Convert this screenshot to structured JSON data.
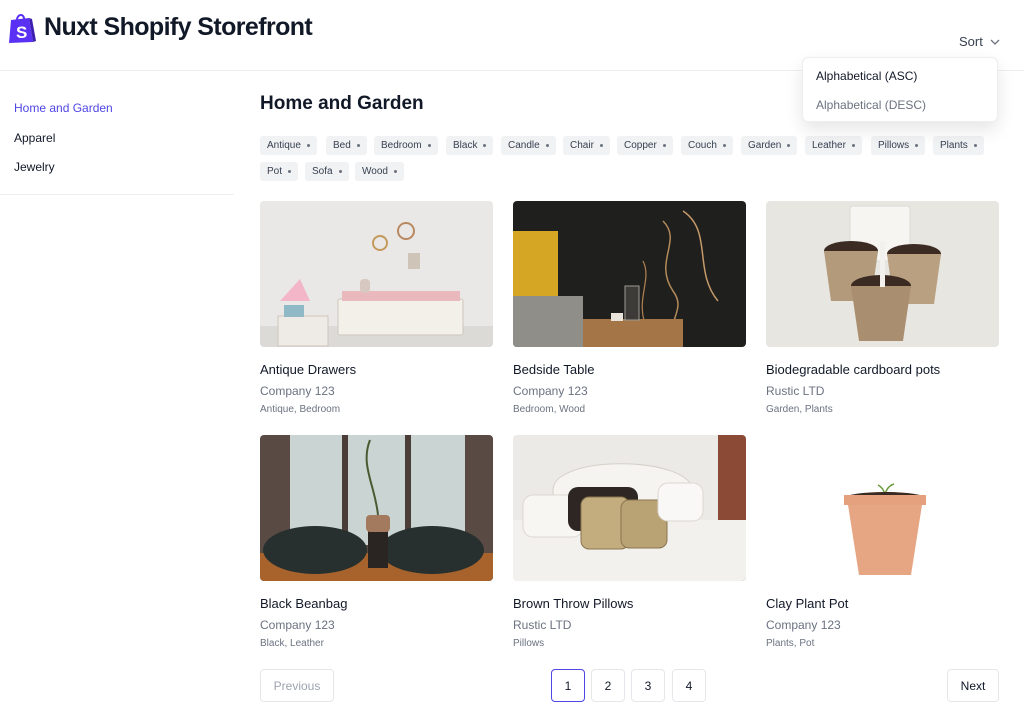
{
  "header": {
    "brand": "Nuxt Shopify Storefront",
    "logo_icon": "shopify-bag-icon",
    "sort_label": "Sort",
    "sort_options": [
      {
        "label": "Alphabetical (ASC)"
      },
      {
        "label": "Alphabetical (DESC)"
      }
    ]
  },
  "sidebar": {
    "items": [
      {
        "label": "Home and Garden",
        "active": true
      },
      {
        "label": "Apparel"
      },
      {
        "label": "Jewelry"
      }
    ]
  },
  "main": {
    "title": "Home and Garden",
    "tags": [
      "Antique",
      "Bed",
      "Bedroom",
      "Black",
      "Candle",
      "Chair",
      "Copper",
      "Couch",
      "Garden",
      "Leather",
      "Pillows",
      "Plants",
      "Pot",
      "Sofa",
      "Wood"
    ],
    "products": [
      {
        "title": "Antique Drawers",
        "vendor": "Company 123",
        "tags": "Antique, Bedroom"
      },
      {
        "title": "Bedside Table",
        "vendor": "Company 123",
        "tags": "Bedroom, Wood"
      },
      {
        "title": "Biodegradable cardboard pots",
        "vendor": "Rustic LTD",
        "tags": "Garden, Plants"
      },
      {
        "title": "Black Beanbag",
        "vendor": "Company 123",
        "tags": "Black, Leather"
      },
      {
        "title": "Brown Throw Pillows",
        "vendor": "Rustic LTD",
        "tags": "Pillows"
      },
      {
        "title": "Clay Plant Pot",
        "vendor": "Company 123",
        "tags": "Plants, Pot"
      }
    ]
  },
  "pagination": {
    "previous": "Previous",
    "next": "Next",
    "pages": [
      "1",
      "2",
      "3",
      "4"
    ],
    "current": "1"
  },
  "colors": {
    "accent": "#4f46e5",
    "logo_green": "#5a31f4",
    "tag_bg": "#f1f2f4"
  }
}
